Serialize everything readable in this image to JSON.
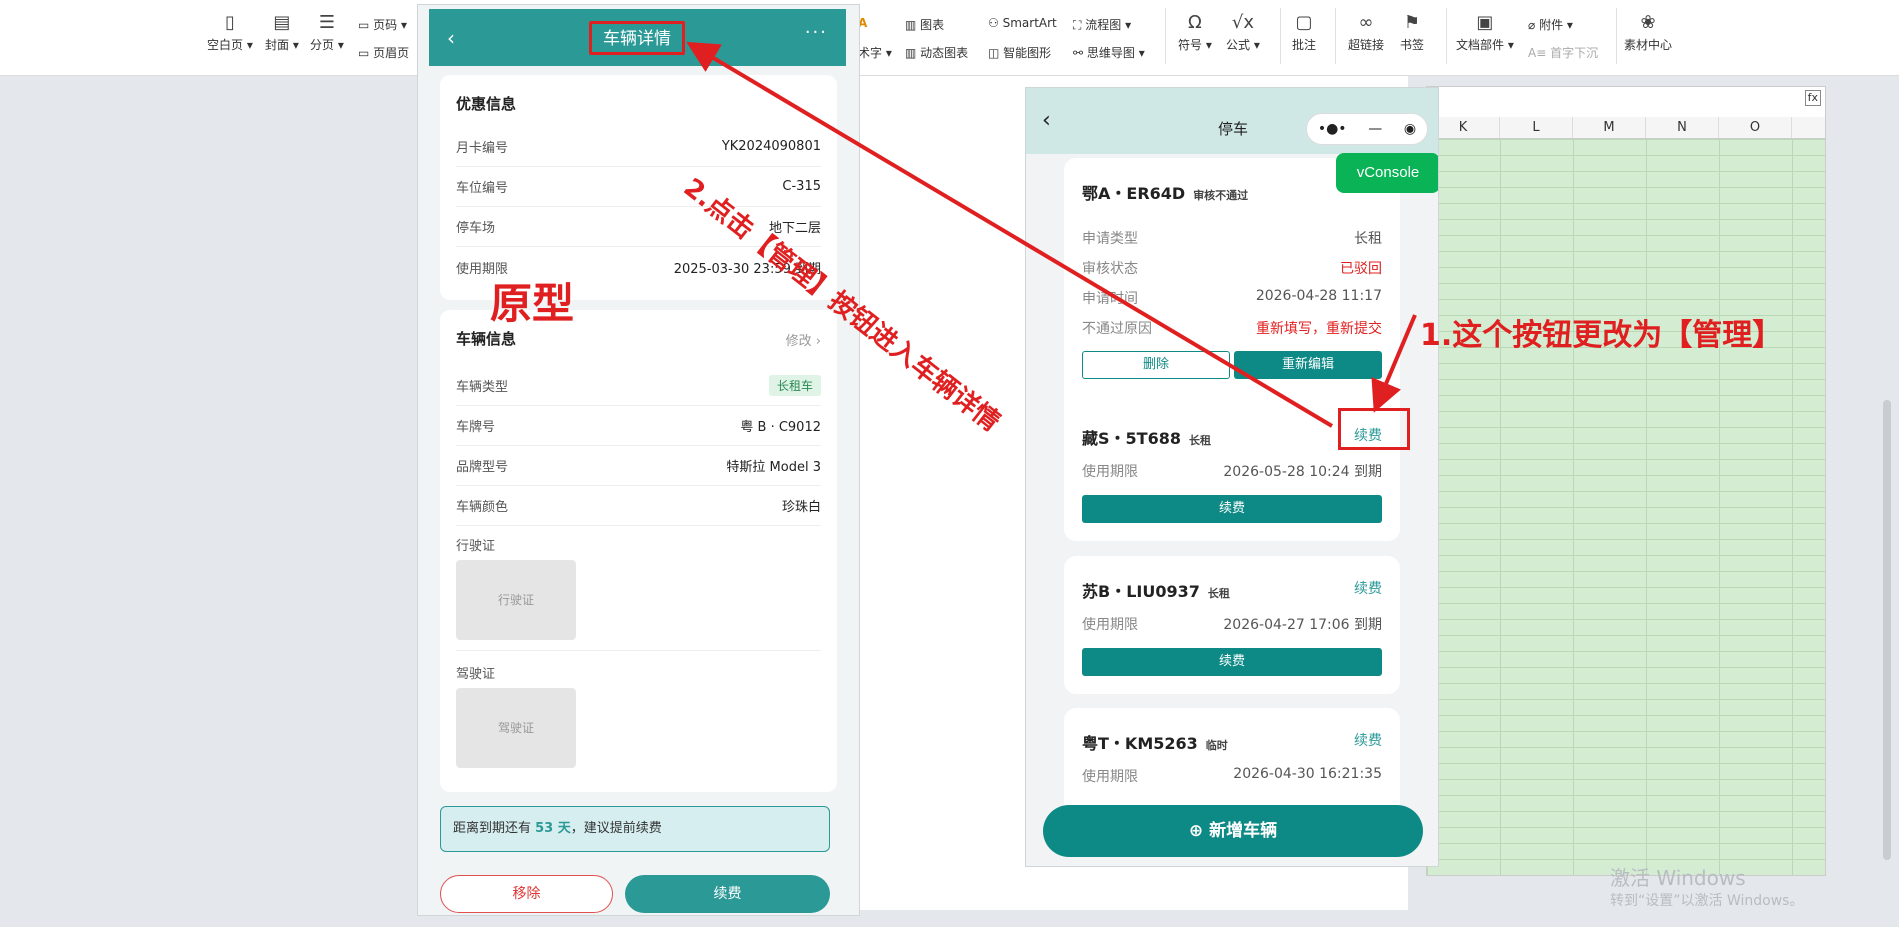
{
  "toolbar": {
    "items": [
      {
        "label": "空白页",
        "icon": "blank-page-icon"
      },
      {
        "label": "封面",
        "icon": "cover-icon"
      },
      {
        "label": "分页",
        "icon": "page-break-icon"
      },
      {
        "label": "页码",
        "icon": "page-number-icon"
      },
      {
        "label": "页眉页"
      }
    ],
    "mid": [
      {
        "label": "术字"
      },
      {
        "label": "图表"
      },
      {
        "label": "动态图表"
      },
      {
        "label": "SmartArt"
      },
      {
        "label": "智能图形"
      },
      {
        "label": "流程图"
      },
      {
        "label": "思维导图"
      }
    ],
    "right": [
      {
        "label": "符号",
        "icon": "omega-icon"
      },
      {
        "label": "公式",
        "icon": "formula-icon"
      },
      {
        "label": "批注",
        "icon": "comment-icon"
      },
      {
        "label": "超链接",
        "icon": "link-icon"
      },
      {
        "label": "书签",
        "icon": "bookmark-icon"
      },
      {
        "label": "文档部件",
        "icon": "doc-part-icon"
      },
      {
        "label": "附件"
      },
      {
        "label": "首字下沉"
      },
      {
        "label": "素材中心",
        "icon": "material-icon"
      }
    ]
  },
  "sheet": {
    "fx": "fx",
    "columns": [
      "K",
      "L",
      "M",
      "N",
      "O"
    ]
  },
  "windows": {
    "line1": "激活 Windows",
    "line2": "转到“设置”以激活 Windows。"
  },
  "left_phone": {
    "back": "‹",
    "title": "车辆详情",
    "more": "···",
    "discount": {
      "title": "优惠信息",
      "rows": [
        {
          "k": "月卡编号",
          "v": "YK2024090801"
        },
        {
          "k": "车位编号",
          "v": "C-315"
        },
        {
          "k": "停车场",
          "v": "地下二层"
        },
        {
          "k": "使用期限",
          "v": "2025-03-30 23:59 到期"
        }
      ]
    },
    "vehicle": {
      "title": "车辆信息",
      "edit": "修改 ›",
      "rows": [
        {
          "k": "车辆类型",
          "v": "长租车"
        },
        {
          "k": "车牌号",
          "v": "粤 B · C9012"
        },
        {
          "k": "品牌型号",
          "v": "特斯拉 Model 3"
        },
        {
          "k": "车辆颜色",
          "v": "珍珠白"
        }
      ],
      "license_label": "行驶证",
      "license_placeholder": "行驶证",
      "driver_label": "驾驶证",
      "driver_placeholder": "驾驶证"
    },
    "notice_pre": "距离到期还有 ",
    "notice_days": "53 天",
    "notice_post": "，建议提前续费",
    "remove": "移除",
    "renew": "续费"
  },
  "prototype_label": "原型",
  "right_phone": {
    "back": "‹",
    "title": "停车",
    "capsule": [
      "•●•",
      "—",
      "◉"
    ],
    "vconsole": "vConsole",
    "cards": [
      {
        "plate": "鄂A・ER64D",
        "tag": "审核不通过",
        "action": "",
        "rows": [
          {
            "k": "申请类型",
            "v": "长租",
            "red": false
          },
          {
            "k": "审核状态",
            "v": "已驳回",
            "red": true
          },
          {
            "k": "申请时间",
            "v": "2026-04-28 11:17",
            "red": false
          },
          {
            "k": "不通过原因",
            "v": "重新填写，重新提交",
            "red": true
          }
        ],
        "delete": "删除",
        "reedit": "重新编辑"
      },
      {
        "plate": "藏S・5T688",
        "tag": "长租",
        "action": "续费",
        "k": "使用期限",
        "v": "2026-05-28 10:24 到期",
        "btn": "续费"
      },
      {
        "plate": "苏B・LIU0937",
        "tag": "长租",
        "action": "续费",
        "k": "使用期限",
        "v": "2026-04-27 17:06 到期",
        "btn": "续费"
      },
      {
        "plate": "粤T・KM5263",
        "tag": "临时",
        "action": "续费",
        "k": "使用期限",
        "v": "2026-04-30 16:21:35"
      }
    ],
    "add_vehicle": "新增车辆"
  },
  "annotations": {
    "step1": "1.这个按钮更改为【管理】",
    "step2": "2.点击【管理】按钮进入车辆详情"
  },
  "colors": {
    "teal": "#2b9a97",
    "annotation_red": "#e02020"
  }
}
